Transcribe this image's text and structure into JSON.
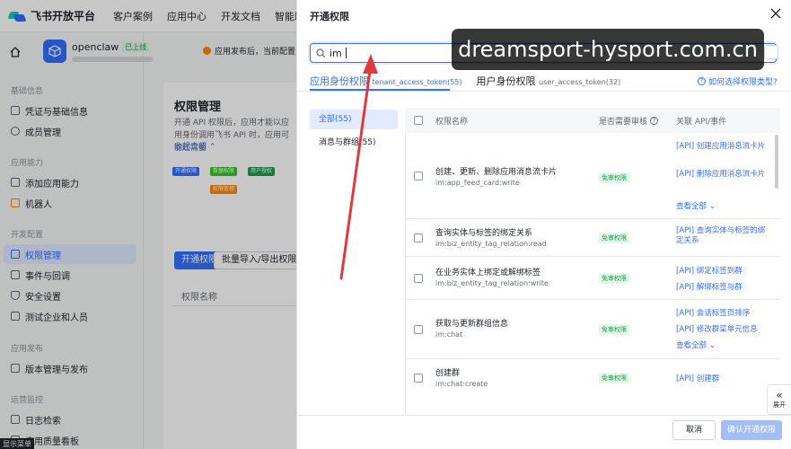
{
  "app": {
    "logo_text": "飞书开放平台"
  },
  "topnav": {
    "items": [
      "客户案例",
      "应用中心",
      "开发文档",
      "智能助"
    ]
  },
  "sidebar": {
    "app_name": "openclaw",
    "app_badge": "已上线",
    "sections": [
      {
        "title": "基础信息",
        "items": [
          "凭证与基础信息",
          "成员管理"
        ]
      },
      {
        "title": "应用能力",
        "items": [
          "添加应用能力",
          "机器人"
        ]
      },
      {
        "title": "开发配置",
        "items": [
          "权限管理",
          "事件与回调",
          "安全设置",
          "测试企业和人员"
        ]
      },
      {
        "title": "应用发布",
        "items": [
          "版本管理与发布"
        ]
      },
      {
        "title": "运营监控",
        "items": [
          "日志检索",
          "应用质量看板"
        ]
      }
    ],
    "active_item": "权限管理",
    "show_menu": "显示菜单"
  },
  "main": {
    "warning": "应用发布后，当前配置",
    "title": "权限管理",
    "desc": "开通 API 权限后，应用才能以应用身份调用飞书 API 时，应用可能还需要",
    "collapse": "收起介绍",
    "diagram_chips": [
      "开通权限",
      "数据权限",
      "权限管理",
      "用户授权"
    ],
    "btn_open": "开通权限",
    "btn_import": "批量导入/导出权限",
    "col_name": "权限名称"
  },
  "drawer": {
    "title": "开通权限",
    "search_value": "im",
    "tabs": [
      {
        "label": "应用身份权限",
        "sub": "tenant_access_token(55)"
      },
      {
        "label": "用户身份权限",
        "sub": "user_access_token(32)"
      }
    ],
    "help": "如何选择权限类型?",
    "categories": [
      "全部(55)",
      "消息与群组(55)"
    ],
    "columns": {
      "name": "权限名称",
      "review": "是否需要审核",
      "api": "关联 API/事件"
    },
    "rows": [
      {
        "name": "创建、更新、删除应用消息流卡片",
        "code": "im:app_feed_card:write",
        "badge": "免审权限",
        "apis": [
          "[API] 创建应用消息流卡片",
          "[API] 删除应用消息流卡片"
        ],
        "more": "查看全部"
      },
      {
        "name": "查询实体与标签的绑定关系",
        "code": "im:biz_entity_tag_relation:read",
        "badge": "免审权限",
        "apis": [
          "[API] 查询实体与标签的绑定关系"
        ],
        "more": ""
      },
      {
        "name": "在业务实体上绑定或解绑标签",
        "code": "im:biz_entity_tag_relation:write",
        "badge": "免审权限",
        "apis": [
          "[API] 绑定标签到群",
          "[API] 解绑标签与群"
        ],
        "more": ""
      },
      {
        "name": "获取与更新群组信息",
        "code": "im:chat",
        "badge": "免审权限",
        "apis": [
          "[API] 会话标签页排序",
          "[API] 修改群菜单元信息"
        ],
        "more": "查看全部"
      },
      {
        "name": "创建群",
        "code": "im:chat:create",
        "badge": "免审权限",
        "apis": [
          "[API] 创建群"
        ],
        "more": ""
      }
    ],
    "cancel": "取消",
    "confirm": "确认开通权限",
    "expand": "展开"
  },
  "watermark": "dreamsport-hysport.com.cn",
  "colors": {
    "accent": "#3370ff",
    "success": "#1e9d4d",
    "warning": "#ff8800",
    "annotation_arrow": "#e0393e"
  }
}
